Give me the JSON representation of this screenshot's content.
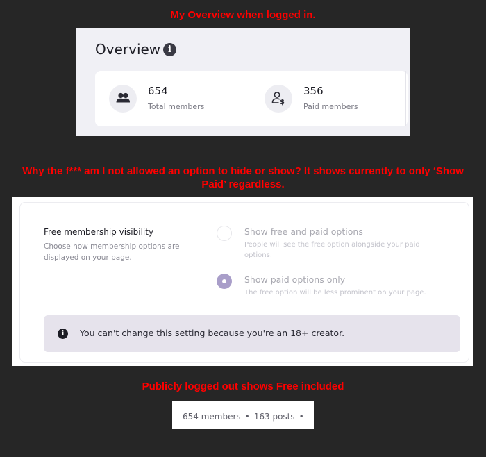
{
  "captions": {
    "logged_in": "My Overview when logged in.",
    "question": "Why the f*** am I not allowed an option to hide or show? It shows currently to only ‘Show Paid’ regardless.",
    "logged_out": "Publicly logged out shows Free included"
  },
  "overview": {
    "title": "Overview",
    "info_icon": "info-icon",
    "stats": [
      {
        "value": "654",
        "label": "Total members",
        "icon": "members-icon"
      },
      {
        "value": "356",
        "label": "Paid members",
        "icon": "paid-member-icon"
      }
    ]
  },
  "settings": {
    "title": "Free membership visibility",
    "description": "Choose how membership options are displayed on your page.",
    "options": [
      {
        "label": "Show free and paid options",
        "description": "People will see the free option alongside your paid options.",
        "selected": false
      },
      {
        "label": "Show paid options only",
        "description": "The free option will be less prominent on your page.",
        "selected": true
      }
    ],
    "notice": "You can't change this setting because you're an 18+ creator."
  },
  "public": {
    "members": "654 members",
    "posts": "163 posts"
  },
  "colors": {
    "caption": "#ff0000",
    "background": "#262626",
    "radio_selected": "#a99ec9",
    "notice_bg": "#e6e3ec"
  }
}
